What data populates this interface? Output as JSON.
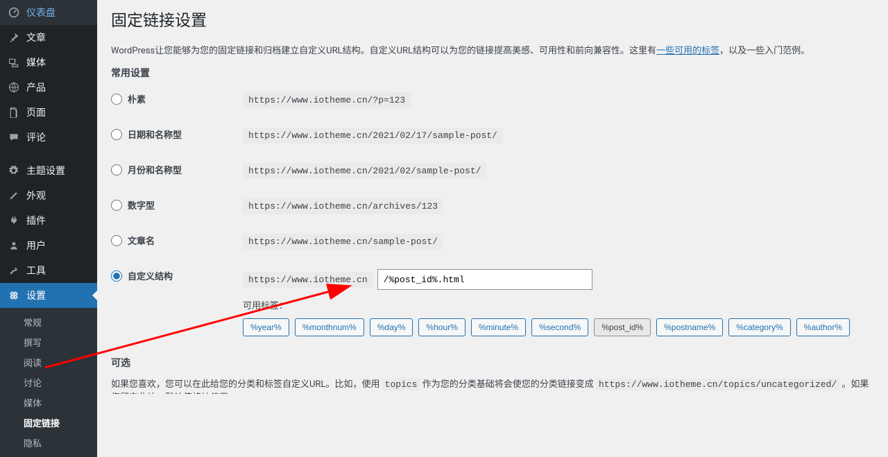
{
  "sidebar": {
    "items": [
      {
        "icon": "dashboard",
        "label": "仪表盘"
      },
      {
        "icon": "pin",
        "label": "文章"
      },
      {
        "icon": "media",
        "label": "媒体"
      },
      {
        "icon": "globe",
        "label": "产品"
      },
      {
        "icon": "page",
        "label": "页面"
      },
      {
        "icon": "comment",
        "label": "评论"
      },
      {
        "icon": "gear",
        "label": "主题设置"
      },
      {
        "icon": "brush",
        "label": "外观"
      },
      {
        "icon": "plugin",
        "label": "插件"
      },
      {
        "icon": "user",
        "label": "用户"
      },
      {
        "icon": "tool",
        "label": "工具"
      },
      {
        "icon": "settings",
        "label": "设置"
      }
    ],
    "submenu": [
      "常规",
      "撰写",
      "阅读",
      "讨论",
      "媒体",
      "固定链接",
      "隐私"
    ]
  },
  "page": {
    "title": "固定链接设置",
    "desc_prefix": "WordPress让您能够为您的固定链接和归档建立自定义URL结构。自定义URL结构可以为您的链接提高美感、可用性和前向兼容性。这里有",
    "desc_link": "一些可用的标签",
    "desc_suffix": "，以及一些入门范例。",
    "sub_header": "常用设置"
  },
  "options": {
    "plain": {
      "label": "朴素",
      "example": "https://www.iotheme.cn/?p=123"
    },
    "daynamed": {
      "label": "日期和名称型",
      "example": "https://www.iotheme.cn/2021/02/17/sample-post/"
    },
    "monthnamed": {
      "label": "月份和名称型",
      "example": "https://www.iotheme.cn/2021/02/sample-post/"
    },
    "numeric": {
      "label": "数字型",
      "example": "https://www.iotheme.cn/archives/123"
    },
    "postname": {
      "label": "文章名",
      "example": "https://www.iotheme.cn/sample-post/"
    },
    "custom": {
      "label": "自定义结构",
      "prefix": "https://www.iotheme.cn",
      "value": "/%post_id%.html",
      "avail_label": "可用标签：",
      "tags": [
        "%year%",
        "%monthnum%",
        "%day%",
        "%hour%",
        "%minute%",
        "%second%",
        "%post_id%",
        "%postname%",
        "%category%",
        "%author%"
      ],
      "active_tag": "%post_id%"
    }
  },
  "optional": {
    "header": "可选",
    "desc1": "如果您喜欢，您可以在此给您的分类和标签自定义URL。比如，使用 ",
    "code1": "topics",
    "desc2": " 作为您的分类基础将会使您的分类链接变成 ",
    "code2": "https://www.iotheme.cn/topics/uncategorized/",
    "desc3": " 。如果您留空此处，默认值将被使用。"
  }
}
